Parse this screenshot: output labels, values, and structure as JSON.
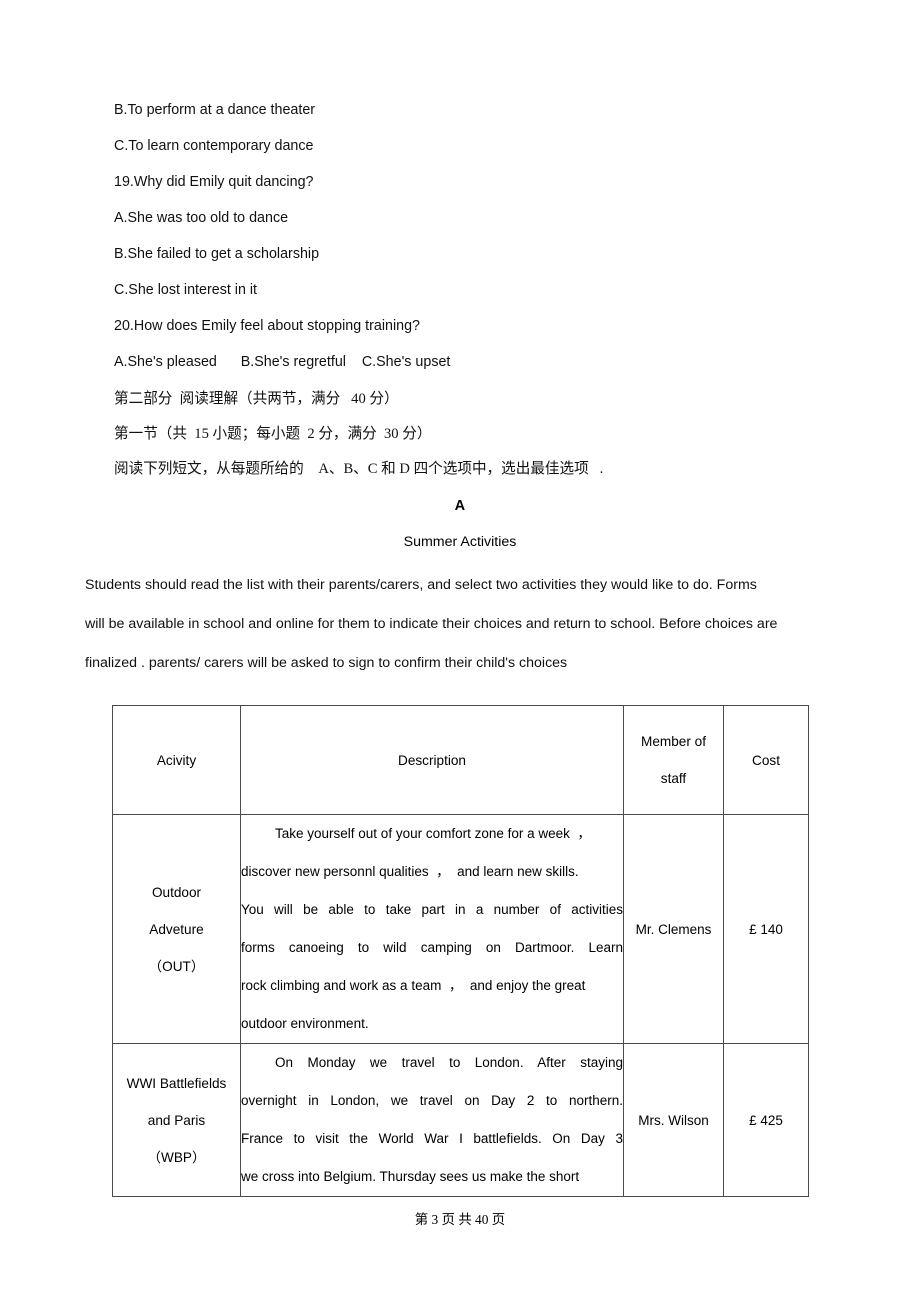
{
  "document": {
    "questions": [
      "B.To perform at a dance theater",
      "C.To learn contemporary dance",
      "19.Why did Emily quit dancing?",
      "A.She was too old to dance",
      "B.She failed to get a scholarship",
      "C.She lost interest in it",
      "20.How does Emily feel about stopping training?",
      "A.She's pleased      B.She's regretful    C.She's upset"
    ],
    "chinese_instructions": [
      "第二部分  阅读理解（共两节，满分   40 分）",
      "第一节（共  15 小题；每小题  2 分，满分  30 分）",
      "阅读下列短文，从每题所给的    A、B、C 和 D 四个选项中，选出最佳选项   ."
    ],
    "section_letter": "A",
    "section_title": "Summer Activities",
    "intro_lines": [
      "Students should read the list with their parents/carers, and select two activities they would like to do. Forms",
      "will be available in school and online for them to indicate their choices and return to school. Before choices are",
      "finalized . parents/ carers will be asked to sign to confirm their child's choices"
    ],
    "table": {
      "headers": {
        "activity": "Acivity",
        "description": "Description",
        "staff_line1": "Member of",
        "staff_line2": "staff",
        "cost": "Cost"
      },
      "rows": [
        {
          "activity_lines": [
            "Outdoor",
            "Adveture",
            "（OUT）"
          ],
          "description_lines": [
            "Take yourself out of your comfort zone for a week  ，",
            "discover new personnl qualities  ，  and learn new skills.",
            "You will be able to take part in a number of activities",
            "forms canoeing to wild camping on Dartmoor. Learn",
            "rock climbing and work as a team  ，  and enjoy the great",
            "outdoor environment."
          ],
          "staff": "Mr. Clemens",
          "cost": "£ 140"
        },
        {
          "activity_lines": [
            "WWI Battlefields",
            "and Paris",
            "（WBP）"
          ],
          "description_lines": [
            "On Monday we travel to London. After staying",
            "overnight in London, we travel on Day 2 to northern.",
            "France to visit the World War I battlefields. On Day 3",
            "we cross into Belgium. Thursday sees us make the short"
          ],
          "staff": "Mrs. Wilson",
          "cost": "£ 425"
        }
      ]
    },
    "footer": "第 3 页 共 40 页"
  }
}
